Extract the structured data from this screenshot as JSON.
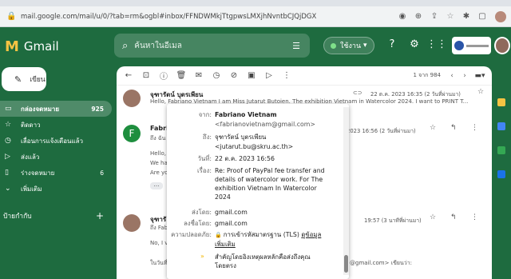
{
  "browser": {
    "url": "mail.google.com/mail/u/0/?tab=rm&ogbl#inbox/FFNDWMkjTtgpwsLMXjhNvntbCJQjDGX",
    "icons": [
      "lock-icon",
      "eye-icon",
      "zoom-icon",
      "share-icon",
      "star-icon",
      "extension-icon",
      "tab-icon",
      "profile-icon"
    ]
  },
  "header": {
    "app_name": "Gmail",
    "search_placeholder": "ค้นหาในอีเมล",
    "status_label": "ใช้งาน",
    "colors": {
      "bg": "#1e6b3f",
      "accent": "#f6c343"
    }
  },
  "sidebar": {
    "compose_label": "เขียน",
    "items": [
      {
        "icon": "inbox-icon",
        "label": "กล่องจดหมาย",
        "count": "925",
        "active": true
      },
      {
        "icon": "star-icon",
        "label": "ติดดาว",
        "count": ""
      },
      {
        "icon": "clock-icon",
        "label": "เลื่อนการแจ้งเตือนแล้ว",
        "count": ""
      },
      {
        "icon": "send-icon",
        "label": "ส่งแล้ว",
        "count": ""
      },
      {
        "icon": "draft-icon",
        "label": "ร่างจดหมาย",
        "count": "6"
      },
      {
        "icon": "chevron-down-icon",
        "label": "เพิ่มเติม",
        "count": ""
      }
    ],
    "labels_heading": "ป้ายกำกับ"
  },
  "toolbar": {
    "count_text": "1 จาก 984"
  },
  "messages": [
    {
      "sender": "จุฑารัตน์ บุตรเพียน",
      "snippet": "Hello, Fabriano Vietnam I am Miss Jutarut Butoien. The exhibition Vietnam in Watercolor 2024. I want to PRINT T...",
      "date": "22 ต.ค. 2023 16:35 (2 วันที่ผ่านมา)"
    },
    {
      "sender": "Fabri",
      "to": "ถึง ฉัน",
      "date": "2023 16:56 (2 วันที่ผ่านมา)",
      "lines": [
        "Hello,",
        "We ha",
        "Are yo"
      ]
    },
    {
      "sender": "จุฑารั",
      "to": "ถึง Fab",
      "date": "19:57 (3 นาทีที่ผ่านมา)",
      "lines": [
        "No, I v",
        "ในวันที่"
      ],
      "quoted": "@gmail.com> เขียนว่า:"
    }
  ],
  "popup": {
    "from_label": "จาก:",
    "from_name": "Fabriano Vietnam",
    "from_email": "<fabrianovietnam@gmail.com>",
    "to_label": "ถึง:",
    "to_name": "จุฑารัตน์ บุตรเพียน",
    "to_email": "<jutarut.bu@skru.ac.th>",
    "date_label": "วันที่:",
    "date": "22 ต.ค. 2023 16:56",
    "subject_label": "เรื่อง:",
    "subject": "Re: Proof of PayPal fee transfer and details of watercolor work. For The exhibition Vietnam In Watercolor 2024",
    "mailedby_label": "ส่งโดย:",
    "mailedby": "gmail.com",
    "signedby_label": "ลงชื่อโดย:",
    "signedby": "gmail.com",
    "security_label": "ความปลอดภัย:",
    "security": "การเข้ารหัสมาตรฐาน (TLS)",
    "security_link": "ดูข้อมูลเพิ่มเติม",
    "importance": "สำคัญโดยอิงเหตุผลหลักคือส่งถึงคุณโดยตรง"
  }
}
